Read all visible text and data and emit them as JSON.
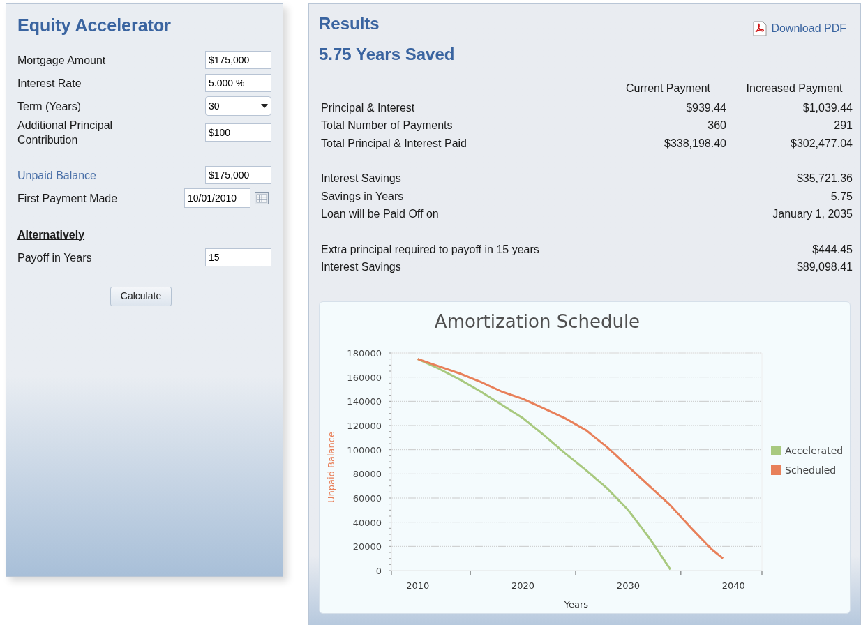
{
  "calculator": {
    "title": "Equity Accelerator",
    "groups": [
      {
        "fields": [
          {
            "kind": "input",
            "label": "Mortgage Amount",
            "value": "$175,000",
            "accent": false
          },
          {
            "kind": "input",
            "label": "Interest Rate",
            "value": "5.000 %",
            "accent": false
          },
          {
            "kind": "select",
            "label": "Term (Years)",
            "value": "30",
            "accent": false
          },
          {
            "kind": "input",
            "label": "Additional Principal Contribution",
            "value": "$100",
            "accent": false
          }
        ]
      },
      {
        "fields": [
          {
            "kind": "input",
            "label": "Unpaid Balance",
            "value": "$175,000",
            "accent": true
          },
          {
            "kind": "date",
            "label": "First Payment Made",
            "value": "10/01/2010",
            "accent": false
          }
        ]
      },
      {
        "heading": "Alternatively",
        "fields": [
          {
            "kind": "input",
            "label": "Payoff in Years",
            "value": "15",
            "accent": false
          }
        ]
      }
    ],
    "button": "Calculate"
  },
  "results": {
    "title": "Results",
    "subtitle": "5.75 Years Saved",
    "download": "Download PDF",
    "columns": [
      "Current Payment",
      "Increased Payment"
    ],
    "groups": [
      [
        {
          "label": "Principal & Interest",
          "current": "$939.44",
          "increased": "$1,039.44"
        },
        {
          "label": "Total Number of Payments",
          "current": "360",
          "increased": "291"
        },
        {
          "label": "Total Principal & Interest Paid",
          "current": "$338,198.40",
          "increased": "$302,477.04"
        }
      ],
      [
        {
          "label": "Interest Savings",
          "increased": "$35,721.36"
        },
        {
          "label": "Savings in Years",
          "increased": "5.75"
        },
        {
          "label": "Loan will be Paid Off on",
          "increased": "January 1, 2035"
        }
      ],
      [
        {
          "label": "Extra principal required to payoff in 15 years",
          "increased": "$444.45"
        },
        {
          "label": "Interest Savings",
          "increased": "$89,098.41"
        }
      ]
    ],
    "chart_data": {
      "type": "line",
      "title": "Amortization Schedule",
      "xlabel": "Years",
      "ylabel": "Unpaid Balance",
      "x": [
        2010,
        2012,
        2014,
        2016,
        2018,
        2020,
        2022,
        2024,
        2026,
        2028,
        2030,
        2032,
        2034,
        2036,
        2038,
        2039
      ],
      "series": [
        {
          "name": "Accelerated",
          "color": "#a8c97f",
          "values": [
            175000,
            167000,
            158000,
            148000,
            137000,
            126000,
            112000,
            97000,
            83000,
            68000,
            50000,
            27000,
            1000,
            null,
            null,
            null
          ]
        },
        {
          "name": "Scheduled",
          "color": "#e8805a",
          "values": [
            175000,
            169000,
            163000,
            156000,
            148000,
            142000,
            134000,
            126000,
            116000,
            102000,
            86000,
            70000,
            54000,
            35000,
            17000,
            10000
          ]
        }
      ],
      "grid": true,
      "legend": true,
      "xlim": [
        2007.5,
        2042.7
      ],
      "ylim": [
        0,
        180000
      ],
      "xticks": [
        2010,
        2020,
        2030,
        2040
      ],
      "yticks": [
        0,
        20000,
        40000,
        60000,
        80000,
        100000,
        120000,
        140000,
        160000,
        180000
      ]
    }
  }
}
